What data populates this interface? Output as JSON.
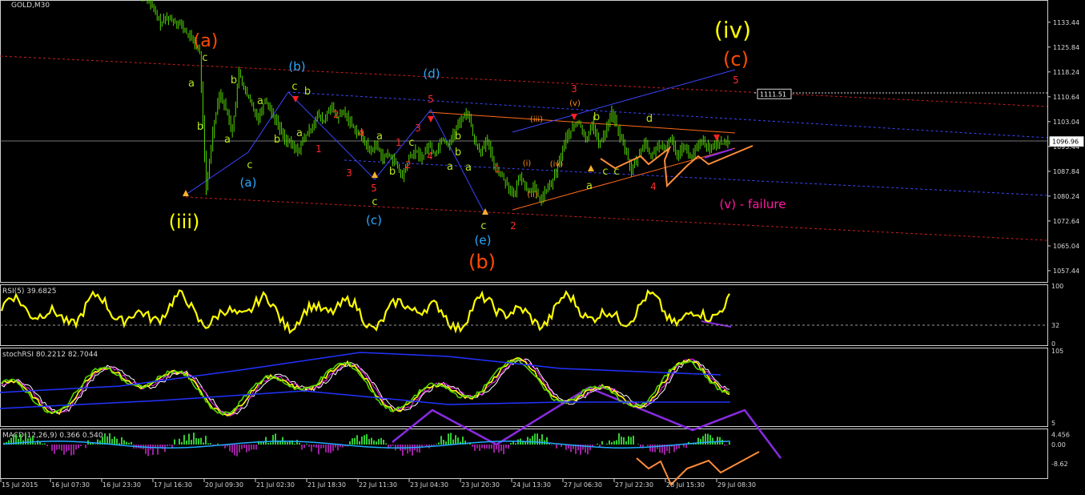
{
  "chart_data": [
    {
      "type": "line",
      "panel": "main",
      "title": "GOLD,M30",
      "ylim": [
        1054.0,
        1140.0
      ],
      "price_ticks": [
        "1133.44",
        "1125.84",
        "1118.24",
        "1110.64",
        "1103.04",
        "1095.44",
        "1087.84",
        "1080.24",
        "1072.64",
        "1065.04",
        "1057.44"
      ],
      "price_tick_values": [
        1133.44,
        1125.84,
        1118.24,
        1110.64,
        1103.04,
        1095.44,
        1087.84,
        1080.24,
        1072.64,
        1065.04,
        1057.44
      ],
      "price_labels": [
        {
          "text": "1111.51",
          "value": 1111.51
        },
        {
          "text": "1096.96",
          "value": 1096.96
        }
      ],
      "series": [
        {
          "values": [
            1141,
            1137,
            1133,
            1135,
            1134,
            1133,
            1130,
            1128,
            1124,
            1082,
            1100,
            1112,
            1107,
            1100,
            1118,
            1112,
            1108,
            1104,
            1110,
            1106,
            1102,
            1098,
            1096,
            1094,
            1098,
            1101,
            1105,
            1103,
            1108,
            1104,
            1106,
            1103,
            1100,
            1098,
            1094,
            1096,
            1092,
            1093,
            1090,
            1086,
            1092,
            1094,
            1092,
            1096,
            1093,
            1098,
            1096,
            1100,
            1104,
            1106,
            1097,
            1094,
            1097,
            1090,
            1087,
            1084,
            1080,
            1087,
            1082,
            1083,
            1079,
            1082,
            1085,
            1091,
            1098,
            1101,
            1103,
            1097,
            1103,
            1096,
            1100,
            1106,
            1100,
            1095,
            1088,
            1092,
            1097,
            1092,
            1096,
            1094,
            1098,
            1093,
            1096,
            1092,
            1095,
            1097,
            1094,
            1097,
            1096,
            1097
          ]
        }
      ],
      "wave_labels": [
        {
          "text": "(a)",
          "color": "#ff4a00"
        },
        {
          "text": "(iii)",
          "color": "#ffff00"
        },
        {
          "text": "(b)",
          "color": "#2ba9ff"
        },
        {
          "text": "(a)",
          "color": "#2ba9ff"
        },
        {
          "text": "(c)",
          "color": "#2ba9ff"
        },
        {
          "text": "(d)",
          "color": "#2ba9ff"
        },
        {
          "text": "(e)",
          "color": "#2ba9ff"
        },
        {
          "text": "(b)",
          "color": "#ff4a00"
        },
        {
          "text": "(iv)",
          "color": "#ffff00"
        },
        {
          "text": "(c)",
          "color": "#ff4a00"
        },
        {
          "text": "(v) - failure",
          "color": "#ff1aa0"
        },
        {
          "text": "c",
          "color": "#b5e61d"
        },
        {
          "text": "a",
          "color": "#b5e61d"
        },
        {
          "text": "b",
          "color": "#b5e61d"
        },
        {
          "text": "b",
          "color": "#b5e61d"
        },
        {
          "text": "a",
          "color": "#b5e61d"
        },
        {
          "text": "c",
          "color": "#b5e61d"
        },
        {
          "text": "a",
          "color": "#b5e61d"
        },
        {
          "text": "b",
          "color": "#b5e61d"
        },
        {
          "text": "c",
          "color": "#b5e61d"
        },
        {
          "text": "b",
          "color": "#b5e61d"
        },
        {
          "text": "a",
          "color": "#b5e61d"
        },
        {
          "text": "c",
          "color": "#b5e61d"
        },
        {
          "text": "a",
          "color": "#b5e61d"
        },
        {
          "text": "b",
          "color": "#b5e61d"
        },
        {
          "text": "c",
          "color": "#b5e61d"
        },
        {
          "text": "b",
          "color": "#b5e61d"
        },
        {
          "text": "a",
          "color": "#b5e61d"
        },
        {
          "text": "b",
          "color": "#b5e61d"
        },
        {
          "text": "a",
          "color": "#b5e61d"
        },
        {
          "text": "c",
          "color": "#b5e61d"
        },
        {
          "text": "c",
          "color": "#b5e61d"
        },
        {
          "text": "d",
          "color": "#b5e61d"
        },
        {
          "text": "a",
          "color": "#b5e61d"
        },
        {
          "text": "c",
          "color": "#b5e61d"
        },
        {
          "text": "b",
          "color": "#b5e61d"
        },
        {
          "text": "1",
          "color": "#ff2a2a"
        },
        {
          "text": "2",
          "color": "#ff2a2a"
        },
        {
          "text": "3",
          "color": "#ff2a2a"
        },
        {
          "text": "4",
          "color": "#ff2a2a"
        },
        {
          "text": "5",
          "color": "#ff2a2a"
        },
        {
          "text": "1",
          "color": "#ff2a2a"
        },
        {
          "text": "2",
          "color": "#ff2a2a"
        },
        {
          "text": "3",
          "color": "#ff2a2a"
        },
        {
          "text": "4",
          "color": "#ff2a2a"
        },
        {
          "text": "5",
          "color": "#ff2a2a"
        },
        {
          "text": "1",
          "color": "#ff2a2a"
        },
        {
          "text": "2",
          "color": "#ff2a2a"
        },
        {
          "text": "3",
          "color": "#ff2a2a"
        },
        {
          "text": "4",
          "color": "#ff2a2a"
        },
        {
          "text": "5",
          "color": "#ff2a2a"
        },
        {
          "text": "(i)",
          "color": "#ff8c1a"
        },
        {
          "text": "(ii)",
          "color": "#ff8c1a"
        },
        {
          "text": "(iii)",
          "color": "#ff8c1a"
        },
        {
          "text": "(iv)",
          "color": "#ff8c1a"
        },
        {
          "text": "(v)",
          "color": "#ff8c1a"
        }
      ]
    },
    {
      "type": "line",
      "panel": "rsi",
      "title": "RSI(5) 39.6825",
      "ylim": [
        0,
        100
      ],
      "ticks": [
        "100",
        "32",
        "0"
      ],
      "tick_values": [
        100,
        32,
        0
      ]
    },
    {
      "type": "line",
      "panel": "stochrsi",
      "title": "stochRSI 80.2212 82.7044",
      "ticks": [
        "105",
        "5"
      ],
      "tick_values": [
        105,
        5
      ]
    },
    {
      "type": "bar",
      "panel": "macd",
      "title": "MACD(12,26,9) 0.366 0.540",
      "ticks": [
        "4.456",
        "0.00",
        "-8.62"
      ],
      "tick_values": [
        4.456,
        0.0,
        -8.62
      ]
    }
  ],
  "x_axis_labels": [
    "15 Jul 2015",
    "16 Jul 07:30",
    "16 Jul 23:30",
    "17 Jul 16:30",
    "20 Jul 09:30",
    "21 Jul 02:30",
    "21 Jul 18:30",
    "22 Jul 11:30",
    "23 Jul 04:30",
    "23 Jul 20:30",
    "24 Jul 13:30",
    "27 Jul 06:30",
    "27 Jul 22:30",
    "28 Jul 15:30",
    "29 Jul 08:30"
  ],
  "colors": {
    "background": "#000000",
    "grid": "#ffffff",
    "candles": "#55d400",
    "rsi": "#ffff00",
    "projection_purple": "#8a2be2",
    "projection_orange": "#ff8c3a",
    "channel_red": "#c81e1e",
    "channel_blue": "#3c46ff"
  }
}
